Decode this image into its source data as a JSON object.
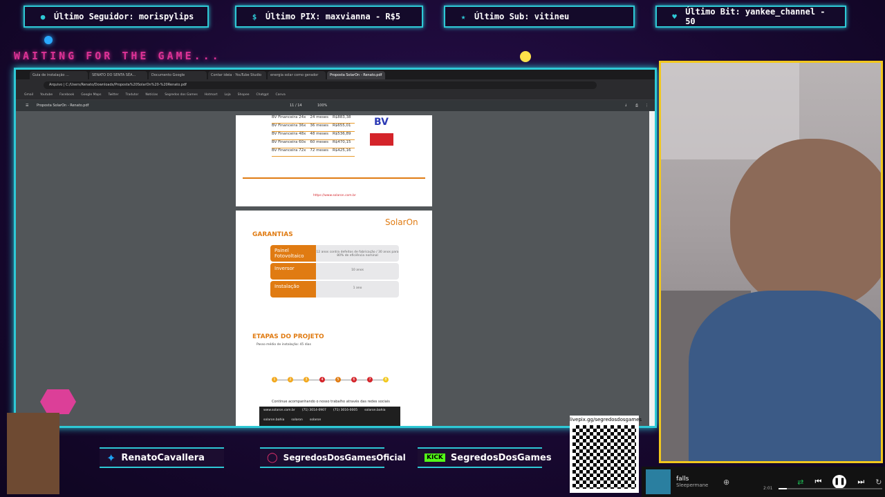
{
  "alerts": [
    {
      "label": "Último Seguidor: morispylips",
      "icon": "person-icon"
    },
    {
      "label": "Último PIX: maxvianna - R$5",
      "icon": "dollar-icon"
    },
    {
      "label": "Último Sub: vitineu",
      "icon": "star-icon"
    },
    {
      "label": "Último Bit: yankee_channel - 50",
      "icon": "heart-icon"
    }
  ],
  "overlay": {
    "waiting_text": "WAITING FOR THE GAME..."
  },
  "browser": {
    "tabs": [
      "Guia de instalação ...",
      "SENATO DO SENTA SÉA...",
      "Documento Google",
      "Contar ideia · YouTube Studio",
      "energia solar como gerador",
      "Proposta SolarOn - Renato.pdf"
    ],
    "url": "Arquivo | C:/Users/Renato/Downloads/Proposta%20SolarOn%20-%20Renato.pdf",
    "bookmarks": [
      "Gmail",
      "Youtube",
      "Facebook",
      "Google Maps",
      "Twitter",
      "Tradutor",
      "Notícias",
      "Segredos dos Games",
      "Hotmart",
      "Loja",
      "Shopee",
      "Chatgpt",
      "Canva"
    ],
    "pdf_title": "Proposta SolarOn - Renato.pdf",
    "pdf_page": "11 / 14",
    "pdf_zoom": "100%"
  },
  "pdf": {
    "financing": [
      {
        "name": "BV Financeira 24x",
        "term": "24 meses",
        "value": "R$883,38"
      },
      {
        "name": "BV Financeira 36x",
        "term": "36 meses",
        "value": "R$655,01"
      },
      {
        "name": "BV Financeira 48x",
        "term": "48 meses",
        "value": "R$536,89"
      },
      {
        "name": "BV Financeira 60x",
        "term": "60 meses",
        "value": "R$470,15"
      },
      {
        "name": "BV Financeira 72x",
        "term": "72 meses",
        "value": "R$425,16"
      }
    ],
    "bv_logo": "BV",
    "footer_url": "https://www.solaron.com.br",
    "brand": "SolarOn",
    "guarantees_title": "GARANTIAS",
    "guarantees": [
      {
        "item": "Painel Fotovoltaico",
        "detail": "12 anos contra defeitos de fabricação / 30 anos para 80% de eficiência nominal"
      },
      {
        "item": "Inversor",
        "detail": "10 anos"
      },
      {
        "item": "Instalação",
        "detail": "1 ano"
      }
    ],
    "stages_title": "ETAPAS DO PROJETO",
    "stages_subtitle": "Passo médio de instalação: 45 dias",
    "stages": [
      "1",
      "2",
      "3",
      "4",
      "5",
      "6",
      "7",
      "8"
    ],
    "social_follow": "Continue acompanhando o nosso trabalho através das redes sociais",
    "contacts": [
      "www.solaron.com.br",
      "(71) 3014-0907",
      "(71) 3016-0005",
      "solaron.bahia",
      "solaron.bahia",
      "solaron",
      "solaron"
    ]
  },
  "socials": {
    "twitter": "RenatoCavallera",
    "instagram": "SegredosDosGamesOficial",
    "kick_badge": "KICK",
    "kick": "SegredosDosGames"
  },
  "qr": {
    "url": "livepix.gg/segredosdosgames"
  },
  "player": {
    "track": "falls",
    "artist": "Sleepermane",
    "time": "2:01",
    "progress": 0.08
  }
}
